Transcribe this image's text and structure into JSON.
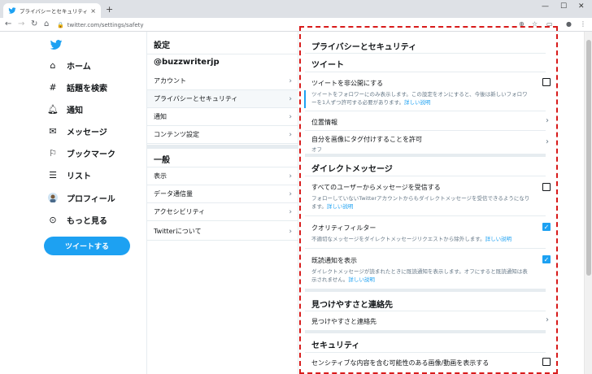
{
  "browser": {
    "tab_title": "プライバシーとセキュリティ / Twitter",
    "tab_close": "×",
    "new_tab": "+",
    "url": "twitter.com/settings/safety",
    "win_min": "—",
    "win_max": "☐",
    "win_close": "✕"
  },
  "nav": {
    "items": [
      {
        "label": "ホーム",
        "icon": "home-icon"
      },
      {
        "label": "話題を検索",
        "icon": "hashtag-icon"
      },
      {
        "label": "通知",
        "icon": "bell-icon"
      },
      {
        "label": "メッセージ",
        "icon": "mail-icon"
      },
      {
        "label": "ブックマーク",
        "icon": "bookmark-icon"
      },
      {
        "label": "リスト",
        "icon": "list-icon"
      },
      {
        "label": "プロフィール",
        "icon": "avatar-icon"
      },
      {
        "label": "もっと見る",
        "icon": "more-icon"
      }
    ],
    "tweet_button": "ツイートする",
    "accent": "#1da1f2"
  },
  "middle": {
    "header": "設定",
    "username": "@buzzwriterjp",
    "account_items": [
      "アカウント",
      "プライバシーとセキュリティ",
      "通知",
      "コンテンツ設定"
    ],
    "general_header": "一般",
    "general_items": [
      "表示",
      "データ通信量",
      "アクセシビリティ",
      "Twitterについて"
    ]
  },
  "settings": {
    "title": "プライバシーとセキュリティ",
    "tweet_section": "ツイート",
    "protect_label": "ツイートを非公開にする",
    "protect_desc": "ツイートをフォロワーにのみ表示します。この設定をオンにすると、今後は新しいフォロワーを1人ずつ許可する必要があります。",
    "learn_more": "詳しい説明",
    "location_label": "位置情報",
    "photo_tag_label": "自分を画像にタグ付けすることを許可",
    "photo_tag_value": "オフ",
    "dm_section": "ダイレクトメッセージ",
    "dm_anyone_label": "すべてのユーザーからメッセージを受信する",
    "dm_anyone_desc": "フォローしていないTwitterアカウントからもダイレクトメッセージを受信できるようになります。",
    "quality_label": "クオリティフィルター",
    "quality_desc": "不適切なメッセージをダイレクトメッセージリクエストから除外します。",
    "read_label": "既読通知を表示",
    "read_desc": "ダイレクトメッセージが読まれたときに既読通知を表示します。オフにすると既読通知は表示されません。",
    "discover_section": "見つけやすさと連絡先",
    "discover_item": "見つけやすさと連絡先",
    "security_section": "セキュリティ",
    "sensitive_label": "センシティブな内容を含む可能性のある画像/動画を表示する",
    "check_mark": "✓"
  }
}
